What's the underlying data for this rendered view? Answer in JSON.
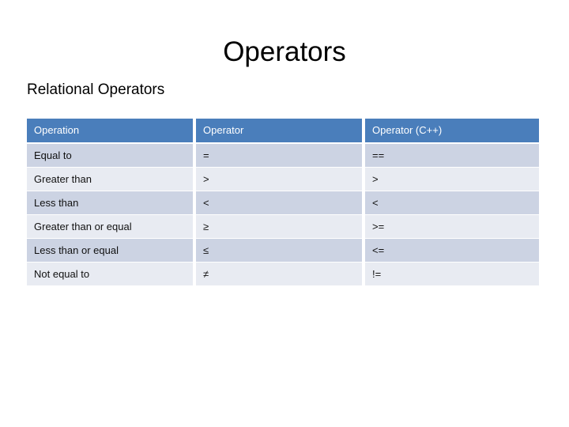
{
  "slide": {
    "title": "Operators",
    "subtitle": "Relational Operators"
  },
  "table": {
    "columns": [
      {
        "key": "operation",
        "label": "Operation"
      },
      {
        "key": "operator",
        "label": "Operator"
      },
      {
        "key": "operator_cpp",
        "label": "Operator (C++)"
      }
    ],
    "rows": [
      {
        "operation": "Equal to",
        "operator": "=",
        "operator_cpp": "=="
      },
      {
        "operation": "Greater than",
        "operator": ">",
        "operator_cpp": ">"
      },
      {
        "operation": "Less than",
        "operator": "<",
        "operator_cpp": "<"
      },
      {
        "operation": "Greater than or equal",
        "operator": "≥",
        "operator_cpp": ">="
      },
      {
        "operation": "Less than or equal",
        "operator": "≤",
        "operator_cpp": "<="
      },
      {
        "operation": "Not equal to",
        "operator": "≠",
        "operator_cpp": "!="
      }
    ]
  },
  "colors": {
    "header_background": "#4a7ebb",
    "header_text": "#ffffff",
    "row_band_dark": "#ccd3e3",
    "row_band_light": "#e8ebf2",
    "page_background": "#ffffff",
    "body_text": "#111111"
  }
}
